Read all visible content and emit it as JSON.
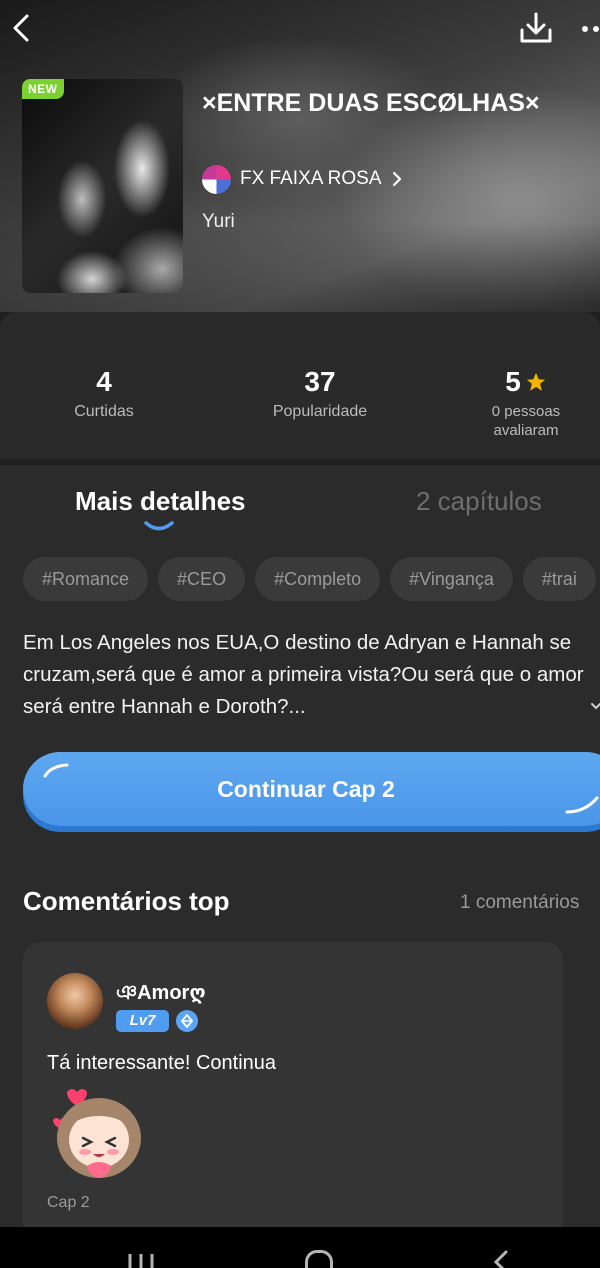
{
  "header": {
    "new_badge": "NEW",
    "title": "×ENTRE DUAS ESCØLHAS×",
    "author": "FX FAIXA ROSA",
    "genre": "Yuri"
  },
  "stats": [
    {
      "value": "4",
      "label": "Curtidas"
    },
    {
      "value": "37",
      "label": "Popularidade"
    },
    {
      "value": "5",
      "label": "0 pessoas avaliaram"
    }
  ],
  "tabs": {
    "details": "Mais detalhes",
    "chapters": "2 capítulos"
  },
  "tags": [
    "#Romance",
    "#CEO",
    "#Completo",
    "#Vingança",
    "#trai"
  ],
  "description": "Em Los Angeles nos EUA,O destino de Adryan e Hannah se cruzam,será que é amor a primeira vista?Ou será que o amor será entre Hannah e Doroth?...",
  "cta_label": "Continuar Cap 2",
  "comments": {
    "title": "Comentários top",
    "count": "1 comentários",
    "items": [
      {
        "user": "ঞAmorღ",
        "level": "Lv7",
        "text": "Tá interessante! Continua",
        "chapter": "Cap 2"
      }
    ]
  },
  "colors": {
    "accent": "#4f9cf0",
    "new_badge": "#7bd12f",
    "star": "#f5b301"
  }
}
